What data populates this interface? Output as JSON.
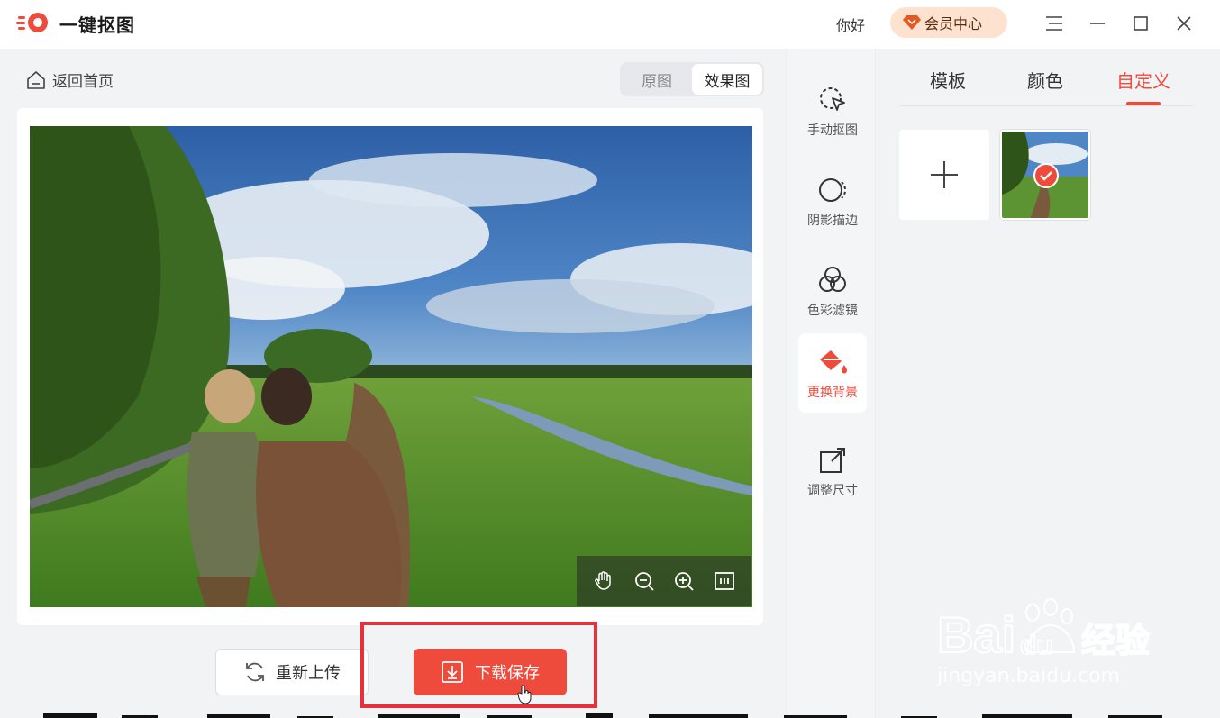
{
  "titlebar": {
    "app_title": "一键抠图",
    "greeting": "你好",
    "vip_label": "会员中心"
  },
  "left": {
    "back_label": "返回首页",
    "view_toggle": [
      {
        "label": "原图",
        "active": false
      },
      {
        "label": "效果图",
        "active": true
      }
    ],
    "zoom_tools": [
      "hand-icon",
      "zoom-out-icon",
      "zoom-in-icon",
      "fit-screen-icon"
    ],
    "reupload_label": "重新上传",
    "download_label": "下载保存"
  },
  "tools": [
    {
      "label": "手动抠图",
      "icon": "manual-cutout-icon",
      "active": false
    },
    {
      "label": "阴影描边",
      "icon": "shadow-outline-icon",
      "active": false
    },
    {
      "label": "色彩滤镜",
      "icon": "color-filter-icon",
      "active": false
    },
    {
      "label": "更换背景",
      "icon": "paint-bucket-icon",
      "active": true
    },
    {
      "label": "调整尺寸",
      "icon": "resize-icon",
      "active": false
    }
  ],
  "right": {
    "tabs": [
      {
        "label": "模板",
        "active": false
      },
      {
        "label": "颜色",
        "active": false
      },
      {
        "label": "自定义",
        "active": true
      }
    ]
  },
  "watermark": {
    "brand": "Bai du 经验",
    "url": "jingyan.baidu.com"
  },
  "colors": {
    "accent": "#ef4b3d",
    "highlight_box": "#e8303a",
    "vip_bg": "#fde3cf"
  }
}
